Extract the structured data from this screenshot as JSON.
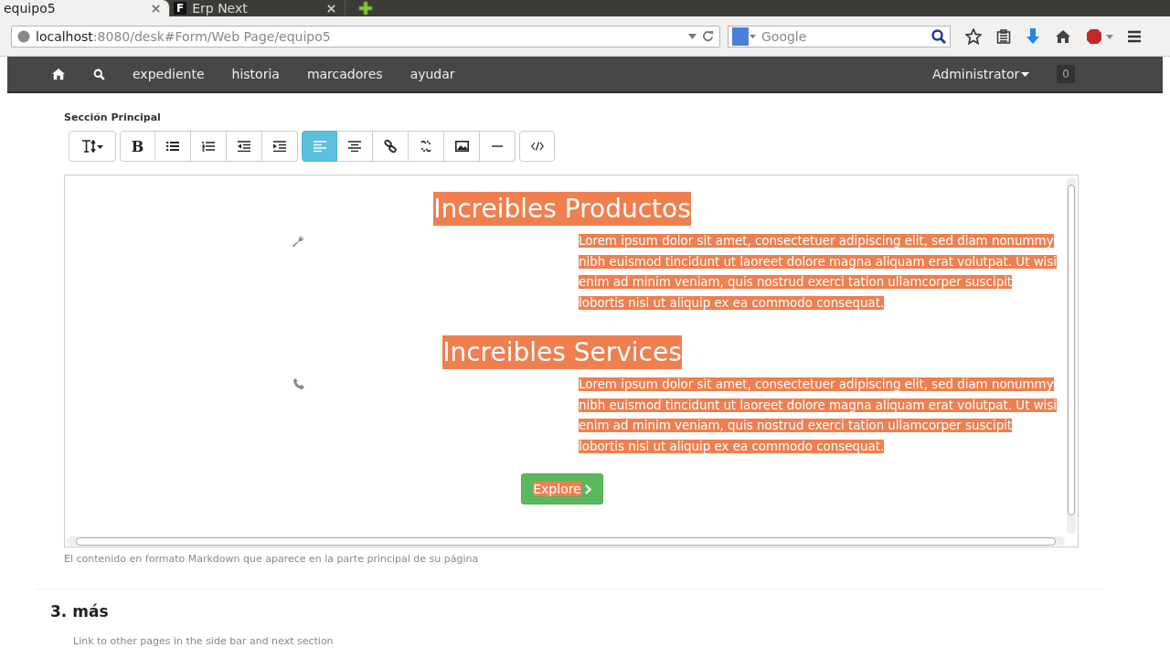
{
  "browser": {
    "tabs": [
      {
        "label": "equipo5",
        "selected": true
      },
      {
        "label": "Erp Next",
        "selected": false,
        "favicon": "F"
      }
    ],
    "url": {
      "host": "localhost",
      "rest": ":8080/desk#Form/Web Page/equipo5"
    },
    "search": {
      "placeholder": "Google"
    }
  },
  "navbar": {
    "links": [
      "expediente",
      "historia",
      "marcadores",
      "ayudar"
    ],
    "user": "Administrator",
    "notifications": "0"
  },
  "section_label": "Sección Principal",
  "toolbar": [
    [
      {
        "kind": "text-size",
        "selected": false
      }
    ],
    [
      {
        "kind": "bold",
        "label": "B",
        "selected": false
      },
      {
        "kind": "bullets",
        "selected": false
      },
      {
        "kind": "numbers",
        "selected": false
      },
      {
        "kind": "outdent",
        "selected": false
      },
      {
        "kind": "indent",
        "selected": false
      }
    ],
    [
      {
        "kind": "align-left",
        "selected": true
      },
      {
        "kind": "align-center",
        "selected": false
      },
      {
        "kind": "link",
        "selected": false
      },
      {
        "kind": "unlink",
        "selected": false
      },
      {
        "kind": "image",
        "selected": false
      },
      {
        "kind": "rule",
        "selected": false
      }
    ],
    [
      {
        "kind": "code",
        "selected": false
      }
    ]
  ],
  "editor": {
    "blocks": [
      {
        "heading": "Increibles Productos",
        "text": "Lorem ipsum dolor sit amet, consectetuer adipiscing elit, sed diam nonummy nibh euismod tincidunt ut laoreet dolore magna aliquam erat volutpat. Ut wisi enim ad minim veniam, quis nostrud exerci tation ullamcorper suscipit lobortis nisl ut aliquip ex ea commodo consequat."
      },
      {
        "heading": "Increibles Services",
        "text": "Lorem ipsum dolor sit amet, consectetuer adipiscing elit, sed diam nonummy nibh euismod tincidunt ut laoreet dolore magna aliquam erat volutpat. Ut wisi enim ad minim veniam, quis nostrud exerci tation ullamcorper suscipit lobortis nisl ut aliquip ex ea commodo consequat."
      }
    ],
    "button": "Explore"
  },
  "help_text": "El contenido en formato Markdown que aparece en la parte principal de su página",
  "next_section": {
    "title": "3. más",
    "description": "Link to other pages in the side bar and next section"
  }
}
